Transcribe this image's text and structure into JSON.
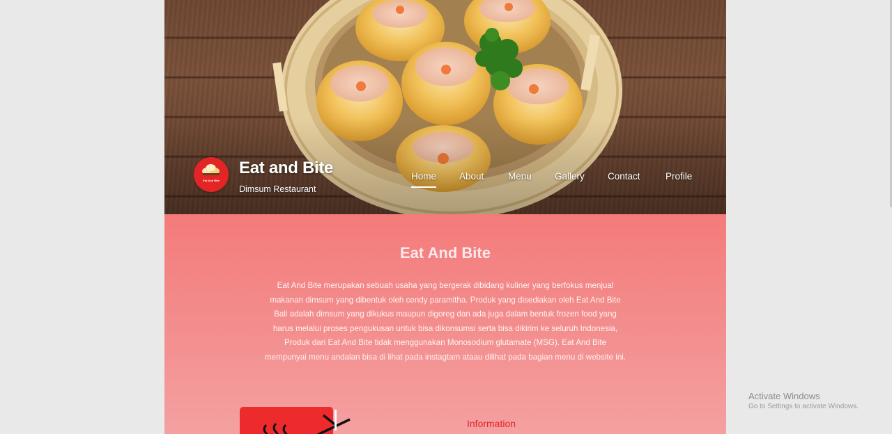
{
  "brand": {
    "logo_text": "Eat And Bite",
    "title": "Eat and Bite",
    "subtitle": "Dimsum Restaurant"
  },
  "nav": {
    "items": [
      {
        "label": "Home",
        "active": true
      },
      {
        "label": "About",
        "active": false
      },
      {
        "label": "Menu",
        "active": false
      },
      {
        "label": "Gallery",
        "active": false
      },
      {
        "label": "Contact",
        "active": false
      },
      {
        "label": "Profile",
        "active": false
      }
    ]
  },
  "about": {
    "title": "Eat And Bite",
    "text": "Eat And Bite merupakan sebuah usaha yang bergerak dibidang kuliner yang berfokus menjual makanan dimsum yang dibentuk oleh cendy paramitha. Produk yang disediakan oleh Eat And Bite Bali adalah dimsum yang dikukus maupun digoreg dan ada juga dalam bentuk frozen food yang harus melalui proses pengukusan untuk bisa dikonsumsi serta bisa dikirim ke seluruh Indonesia, Produk dari Eat And Bite tidak menggunakan Monosodium glutamate (MSG). Eat And Bite mempunyai menu andalan bisa di lihat pada instagtam ataau dilihat pada bagian menu di website ini."
  },
  "info": {
    "title": "Information"
  },
  "os_watermark": {
    "title": "Activate Windows",
    "subtitle": "Go to Settings to activate Windows."
  },
  "colors": {
    "brand_red": "#e42526",
    "section_top": "#f47b7a",
    "section_bottom": "#f4a0a1"
  }
}
